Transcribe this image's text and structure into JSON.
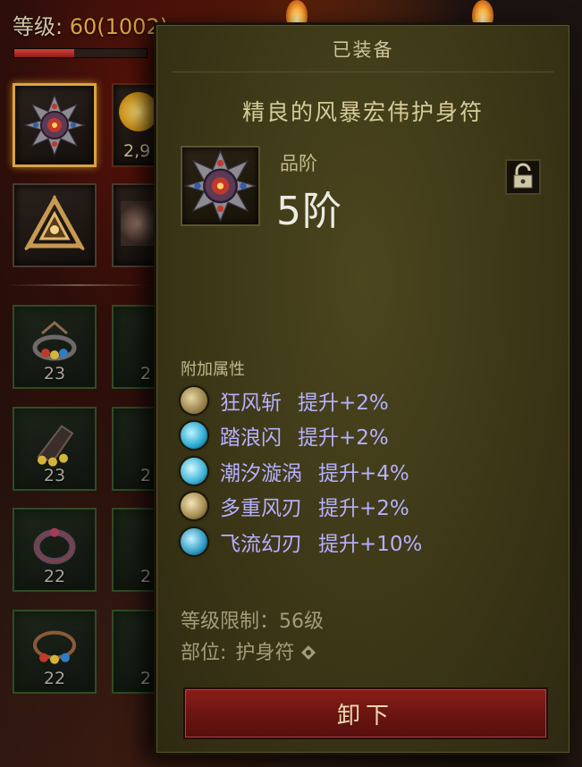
{
  "character": {
    "level_label": "等级: ",
    "level": "60",
    "paragon": "(1002)",
    "exp_fraction": 0.45
  },
  "inventory": {
    "currency_amount": "2,9",
    "slots": [
      {
        "level": "23"
      },
      {
        "level": "23"
      },
      {
        "level": "22"
      },
      {
        "level": "22"
      }
    ],
    "partial_slots": [
      {
        "level": "2"
      },
      {
        "level": "2"
      },
      {
        "level": "2"
      },
      {
        "level": "2"
      }
    ]
  },
  "tooltip": {
    "header": "已装备",
    "item_name": "精良的风暴宏伟护身符",
    "grade_label": "品阶",
    "grade_value": "5阶",
    "attributes_header": "附加属性",
    "attributes": [
      {
        "name": "狂风斩",
        "value": "提升+2%",
        "icon": "gust-slash-icon"
      },
      {
        "name": "踏浪闪",
        "value": "提升+2%",
        "icon": "wave-dash-icon"
      },
      {
        "name": "潮汐漩涡",
        "value": "提升+4%",
        "icon": "tidal-vortex-icon"
      },
      {
        "name": "多重风刃",
        "value": "提升+2%",
        "icon": "multi-wind-blade-icon"
      },
      {
        "name": "飞流幻刃",
        "value": "提升+10%",
        "icon": "phantom-blade-icon"
      }
    ],
    "level_req_label": "等级限制：",
    "level_req_value": "56级",
    "slot_label": "部位:",
    "slot_value": "护身符",
    "unequip_label": "卸下"
  },
  "colors": {
    "attribute_text": "#b6b0ff",
    "selected_border": "#d9a441",
    "unequip_button": "#6a1410"
  }
}
